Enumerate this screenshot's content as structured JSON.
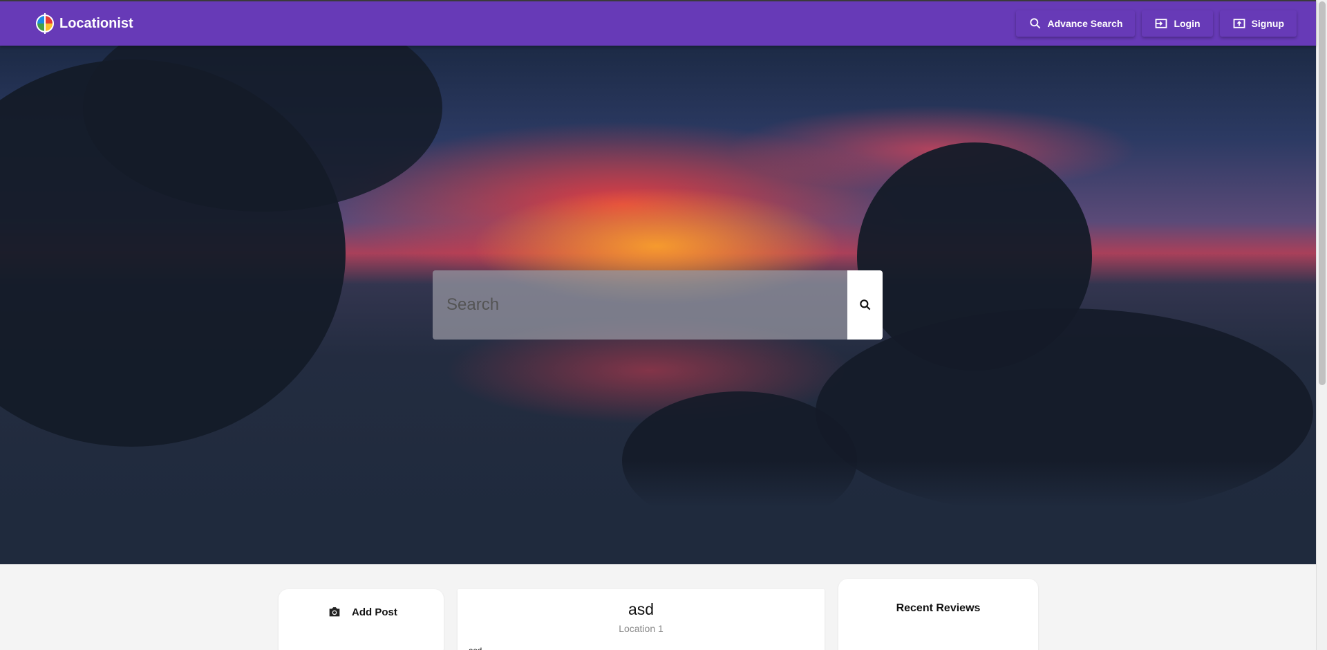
{
  "header": {
    "brand": "Locationist",
    "nav": [
      {
        "label": "Advance Search",
        "icon": "search-icon"
      },
      {
        "label": "Login",
        "icon": "login-icon"
      },
      {
        "label": "Signup",
        "icon": "signup-icon"
      }
    ]
  },
  "hero": {
    "search_placeholder": "Search",
    "search_icon": "search-icon"
  },
  "add_post": {
    "label": "Add Post",
    "icon": "camera-icon"
  },
  "post": {
    "title": "asd",
    "location": "Location 1",
    "body": "asd"
  },
  "recent_reviews": {
    "title": "Recent Reviews"
  },
  "colors": {
    "primary": "#673ab7",
    "background": "#f4f4f4"
  }
}
